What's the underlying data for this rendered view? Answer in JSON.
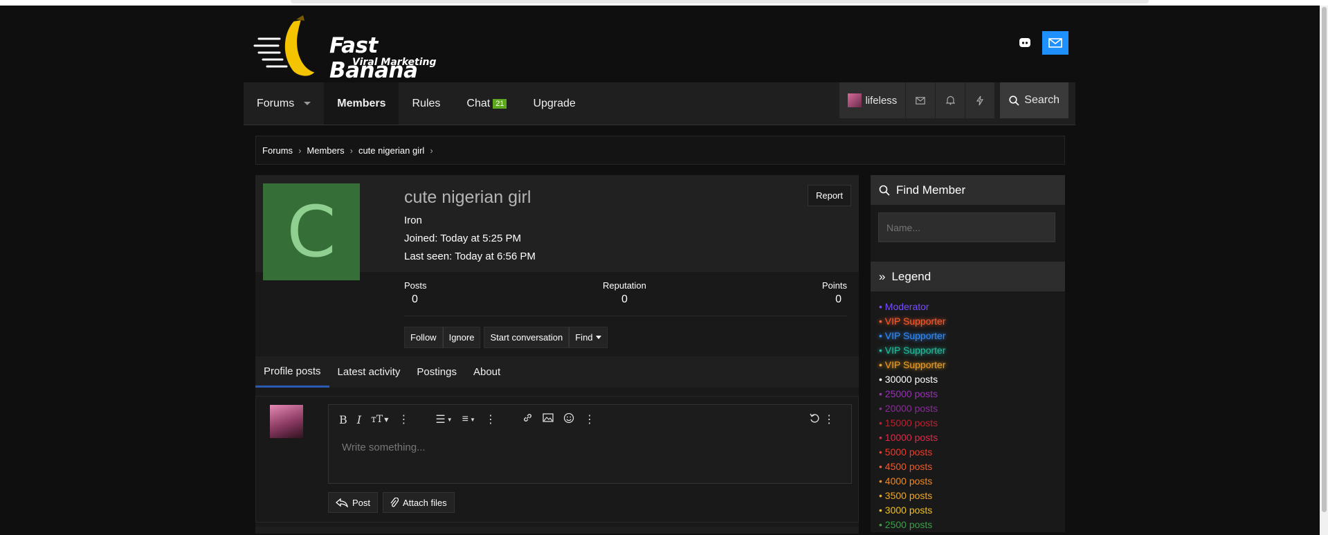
{
  "brand": {
    "name": "Fast Banana",
    "tagline": "Viral Marketing"
  },
  "nav": {
    "items": [
      {
        "label": "Forums"
      },
      {
        "label": "Members"
      },
      {
        "label": "Rules"
      },
      {
        "label": "Chat",
        "badge": "21"
      },
      {
        "label": "Upgrade"
      }
    ],
    "user": "lifeless",
    "search_label": "Search"
  },
  "breadcrumb": [
    "Forums",
    "Members",
    "cute nigerian girl"
  ],
  "profile": {
    "initial": "C",
    "username": "cute nigerian girl",
    "report_label": "Report",
    "user_title": "Iron",
    "joined": "Joined: Today at 5:25 PM",
    "last_seen": "Last seen: Today at 6:56 PM",
    "stats": {
      "posts_label": "Posts",
      "posts": "0",
      "reputation_label": "Reputation",
      "reputation": "0",
      "points_label": "Points",
      "points": "0"
    },
    "actions": {
      "follow": "Follow",
      "ignore": "Ignore",
      "start_conversation": "Start conversation",
      "find": "Find"
    },
    "tabs": [
      "Profile posts",
      "Latest activity",
      "Postings",
      "About"
    ]
  },
  "composer": {
    "placeholder": "Write something...",
    "post_label": "Post",
    "attach_label": "Attach files"
  },
  "sidebar": {
    "find_member_title": "Find Member",
    "find_member_placeholder": "Name...",
    "legend_title": "Legend",
    "legend": [
      {
        "label": "• Moderator",
        "color": "#7a4cff",
        "glow": false
      },
      {
        "label": "• VIP Supporter",
        "color": "#ff5a2b",
        "glow": true
      },
      {
        "label": "• VIP Supporter",
        "color": "#2f8cff",
        "glow": true
      },
      {
        "label": "• VIP Supporter",
        "color": "#1fbfa0",
        "glow": true
      },
      {
        "label": "• VIP Supporter",
        "color": "#f0a020",
        "glow": true
      },
      {
        "label": "• 30000 posts",
        "color": "#ffffff",
        "glow": false
      },
      {
        "label": "• 25000 posts",
        "color": "#9a2fb8",
        "glow": false
      },
      {
        "label": "• 20000 posts",
        "color": "#8a2a9a",
        "glow": false
      },
      {
        "label": "• 15000 posts",
        "color": "#c0202e",
        "glow": false
      },
      {
        "label": "• 10000 posts",
        "color": "#e0284a",
        "glow": false
      },
      {
        "label": "• 5000 posts",
        "color": "#f03a2a",
        "glow": false
      },
      {
        "label": "• 4500 posts",
        "color": "#f05a2a",
        "glow": false
      },
      {
        "label": "• 4000 posts",
        "color": "#f08a20",
        "glow": false
      },
      {
        "label": "• 3500 posts",
        "color": "#f0a820",
        "glow": false
      },
      {
        "label": "• 3000 posts",
        "color": "#f0c020",
        "glow": false
      },
      {
        "label": "• 2500 posts",
        "color": "#3aa048",
        "glow": false
      }
    ]
  }
}
